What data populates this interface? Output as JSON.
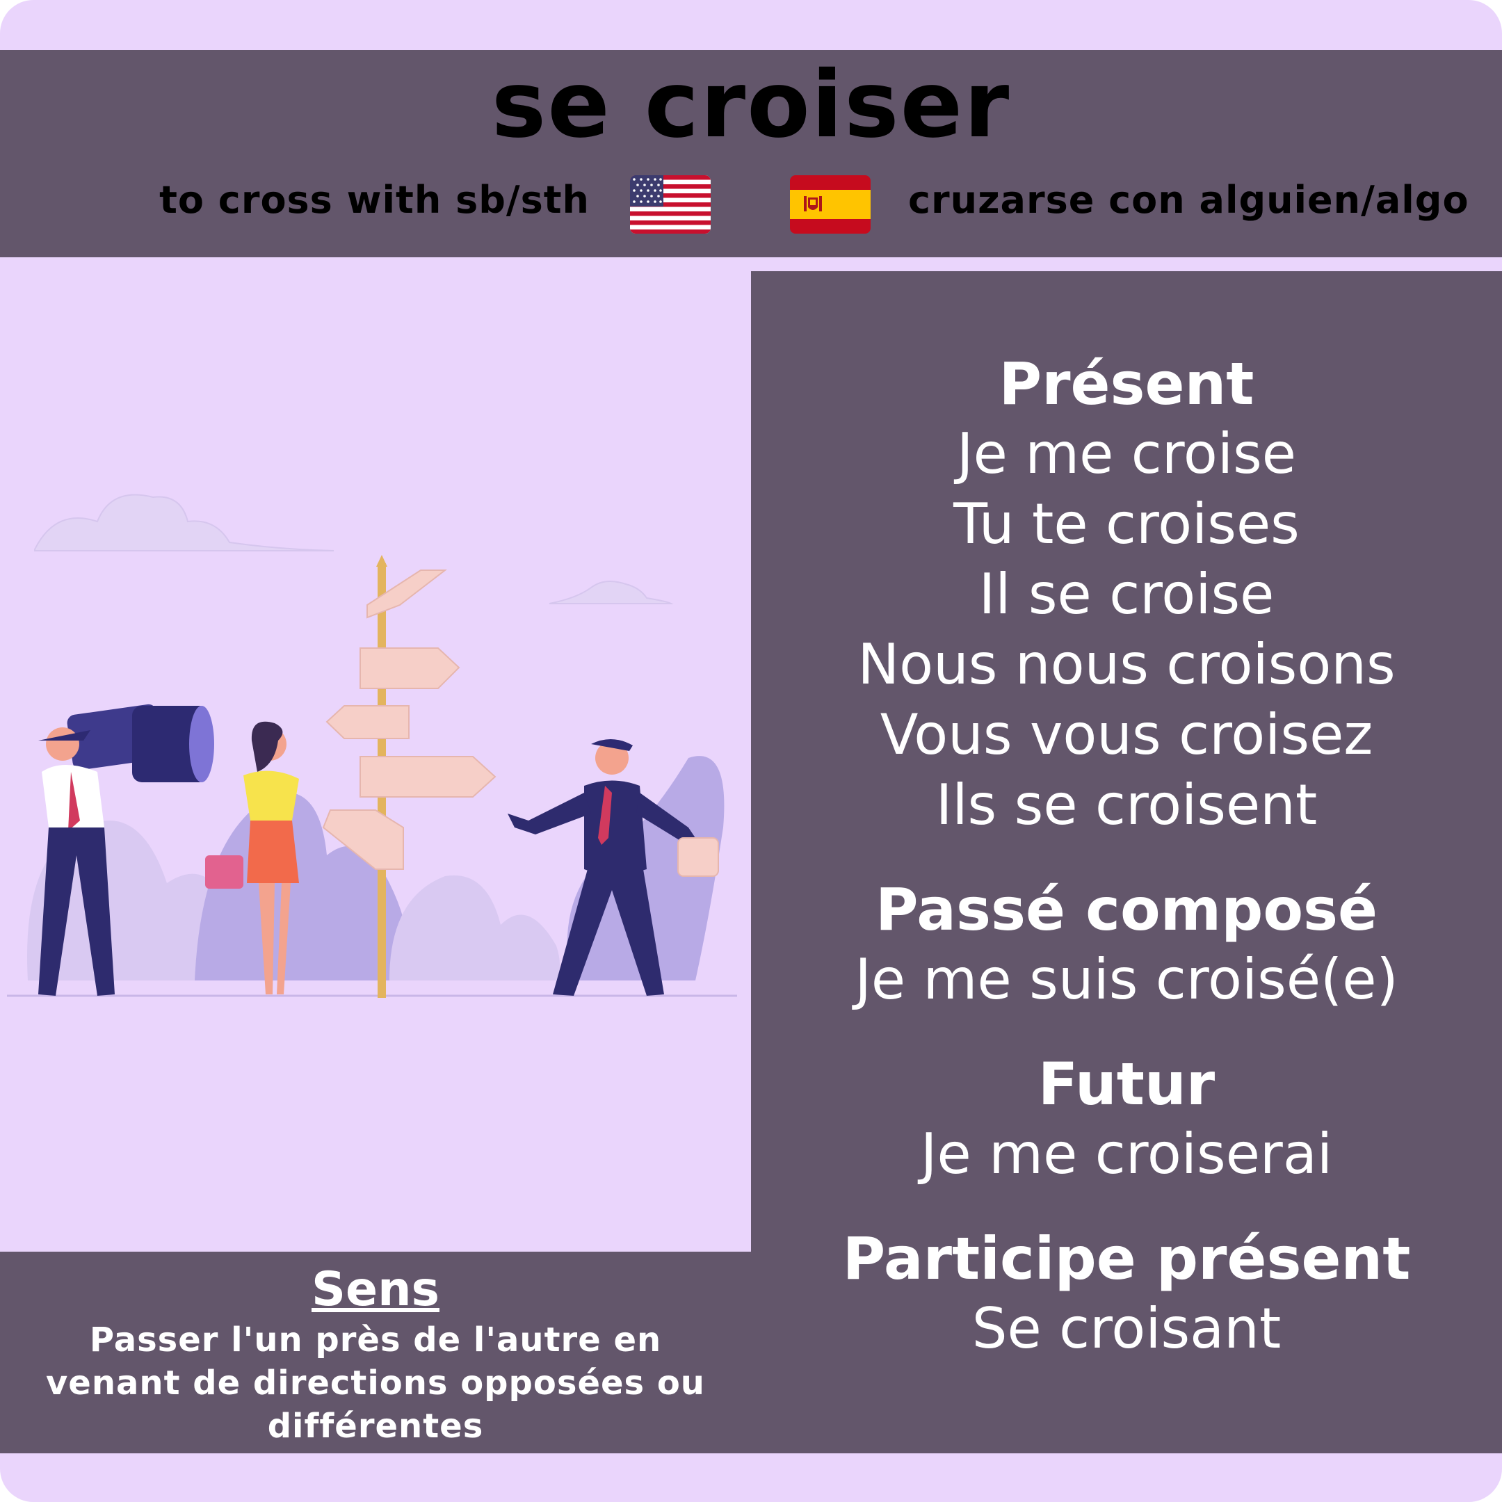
{
  "verb": "se croiser",
  "translations": {
    "english": "to cross with sb/sth",
    "spanish": "cruzarse con alguien/algo"
  },
  "flags": {
    "english": "us-flag-icon",
    "spanish": "spain-flag-icon"
  },
  "conjugation": {
    "present": {
      "label": "Présent",
      "forms": [
        "Je me croise",
        "Tu te croises",
        "Il se croise",
        "Nous nous croisons",
        "Vous vous croisez",
        "Ils se croisent"
      ]
    },
    "passe_compose": {
      "label": "Passé composé",
      "form": "Je me suis croisé(e)"
    },
    "futur": {
      "label": "Futur",
      "form": "Je me croiserai"
    },
    "participe_present": {
      "label": "Participe présent",
      "form": "Se croisant"
    }
  },
  "sens": {
    "label": "Sens",
    "text": "Passer l'un près de l'autre en venant de directions opposées ou différentes"
  },
  "colors": {
    "background": "#ead5fc",
    "panel": "#63566b",
    "text": "#ffffff"
  }
}
